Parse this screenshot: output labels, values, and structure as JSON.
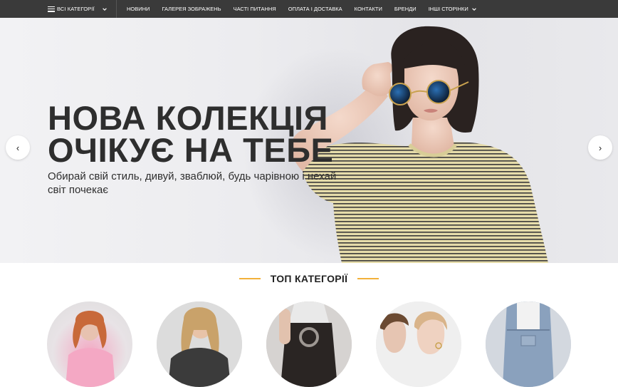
{
  "nav": {
    "all_categories": "ВСІ КАТЕГОРІЇ",
    "items": [
      "НОВИНИ",
      "ГАЛЕРЕЯ ЗОБРАЖЕНЬ",
      "ЧАСТІ ПИТАННЯ",
      "ОПЛАТА І ДОСТАВКА",
      "КОНТАКТИ",
      "БРЕНДИ",
      "ІНШІ СТОРІНКИ"
    ]
  },
  "hero": {
    "title_line1": "НОВА КОЛЕКЦІЯ",
    "title_line2": "ОЧІКУЄ НА ТЕБЕ",
    "subtitle": "Обирай свій стиль, дивуй, зваблюй, будь чарівною і нехай світ почекає",
    "prev_label": "‹",
    "next_label": "›"
  },
  "categories": {
    "title": "ТОП КАТЕГОРІЇ",
    "accent_color": "#f2b13a"
  }
}
